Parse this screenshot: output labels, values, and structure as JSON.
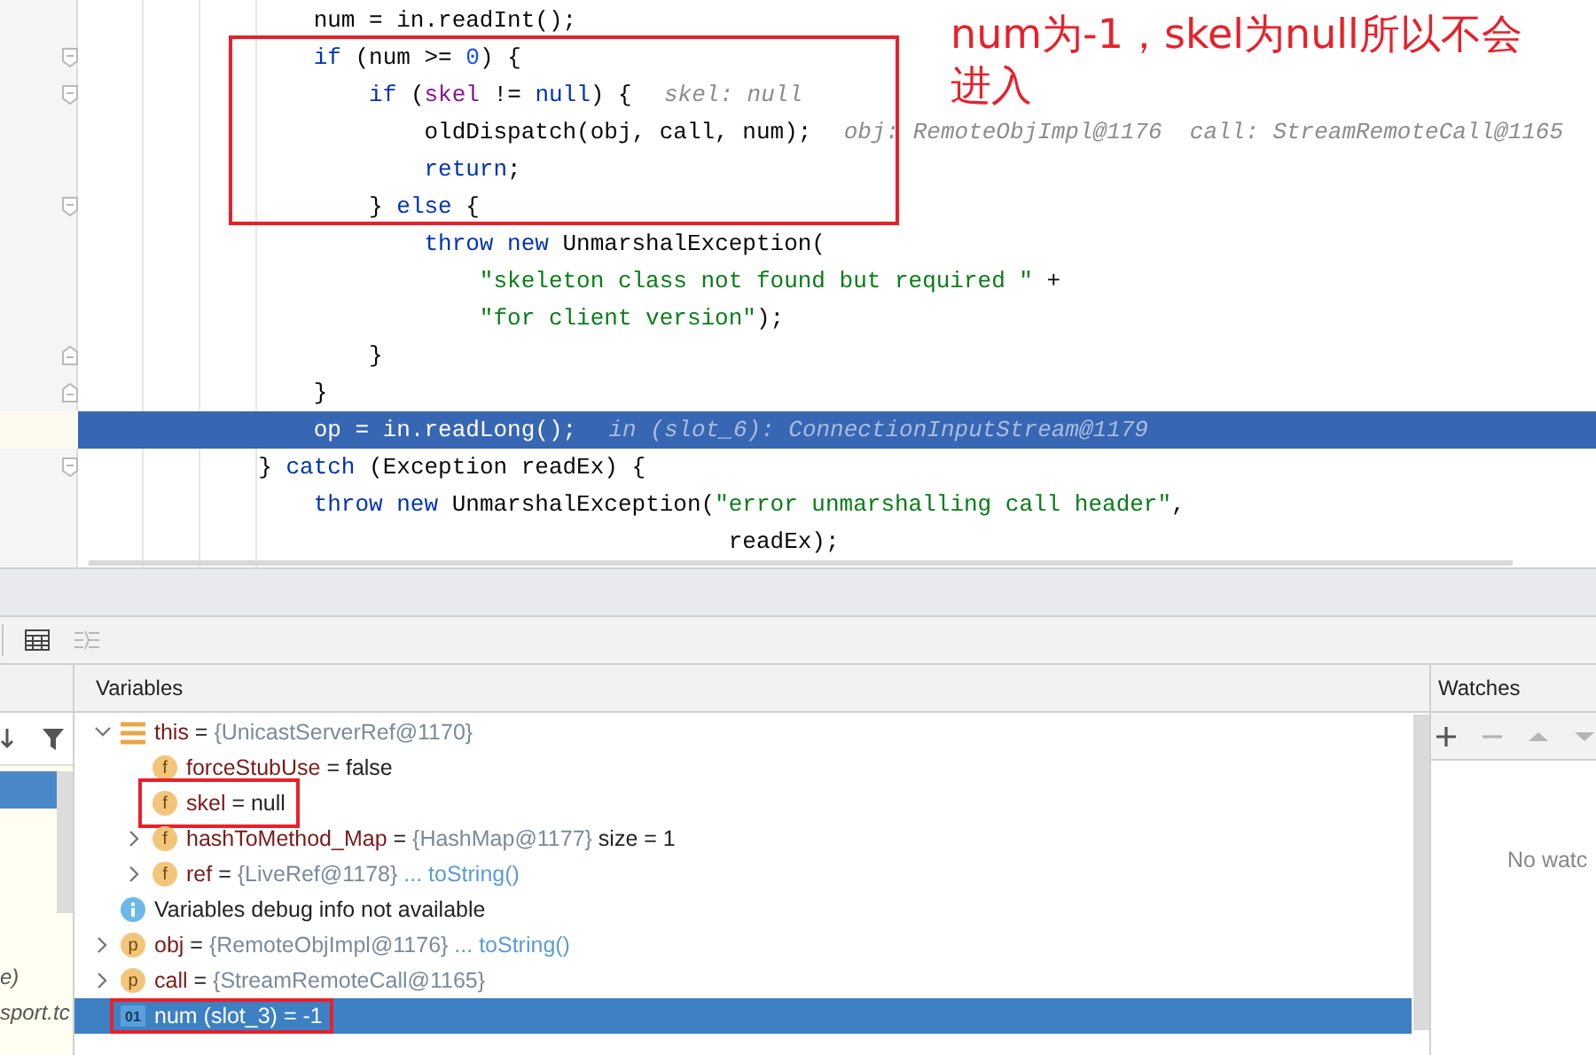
{
  "editor": {
    "lines": [
      {
        "fold_start": false,
        "fold_end": false,
        "current": false,
        "tokens": [
          {
            "kind": "plain",
            "text": "                num = in.readInt();"
          }
        ]
      },
      {
        "fold_start": true,
        "fold_end": false,
        "current": false,
        "tokens": [
          {
            "kind": "keyword",
            "text": "                if"
          },
          {
            "kind": "plain",
            "text": " (num >= "
          },
          {
            "kind": "number",
            "text": "0"
          },
          {
            "kind": "plain",
            "text": ") {"
          }
        ]
      },
      {
        "fold_start": true,
        "fold_end": false,
        "current": false,
        "tokens": [
          {
            "kind": "keyword",
            "text": "                    if"
          },
          {
            "kind": "plain",
            "text": " ("
          },
          {
            "kind": "field",
            "text": "skel"
          },
          {
            "kind": "plain",
            "text": " != "
          },
          {
            "kind": "keyword",
            "text": "null"
          },
          {
            "kind": "plain",
            "text": ") {"
          },
          {
            "kind": "hint",
            "text": "skel: null"
          }
        ]
      },
      {
        "fold_start": false,
        "fold_end": false,
        "current": false,
        "tokens": [
          {
            "kind": "plain",
            "text": "                        oldDispatch(obj, call, num);"
          },
          {
            "kind": "hint",
            "text": "obj: RemoteObjImpl@1176  call: StreamRemoteCall@1165"
          }
        ]
      },
      {
        "fold_start": false,
        "fold_end": false,
        "current": false,
        "tokens": [
          {
            "kind": "keyword",
            "text": "                        return"
          },
          {
            "kind": "plain",
            "text": ";"
          }
        ]
      },
      {
        "fold_start": true,
        "fold_end": false,
        "current": false,
        "tokens": [
          {
            "kind": "plain",
            "text": "                    } "
          },
          {
            "kind": "keyword",
            "text": "else"
          },
          {
            "kind": "plain",
            "text": " {"
          }
        ]
      },
      {
        "fold_start": false,
        "fold_end": false,
        "current": false,
        "tokens": [
          {
            "kind": "keyword",
            "text": "                        throw new"
          },
          {
            "kind": "plain",
            "text": " UnmarshalException("
          }
        ]
      },
      {
        "fold_start": false,
        "fold_end": false,
        "current": false,
        "tokens": [
          {
            "kind": "string",
            "text": "                            \"skeleton class not found but required \""
          },
          {
            "kind": "plain",
            "text": " +"
          }
        ]
      },
      {
        "fold_start": false,
        "fold_end": false,
        "current": false,
        "tokens": [
          {
            "kind": "string",
            "text": "                            \"for client version\""
          },
          {
            "kind": "plain",
            "text": ");"
          }
        ]
      },
      {
        "fold_start": false,
        "fold_end": true,
        "current": false,
        "tokens": [
          {
            "kind": "plain",
            "text": "                    }"
          }
        ]
      },
      {
        "fold_start": false,
        "fold_end": true,
        "current": false,
        "tokens": [
          {
            "kind": "plain",
            "text": "                }"
          }
        ]
      },
      {
        "fold_start": false,
        "fold_end": false,
        "current": true,
        "tokens": [
          {
            "kind": "plain",
            "text": "                op = in.readLong();"
          },
          {
            "kind": "hint",
            "text": "in (slot_6): ConnectionInputStream@1179"
          }
        ]
      },
      {
        "fold_start": true,
        "fold_end": false,
        "current": false,
        "tokens": [
          {
            "kind": "plain",
            "text": "            } "
          },
          {
            "kind": "keyword",
            "text": "catch"
          },
          {
            "kind": "plain",
            "text": " (Exception readEx) {"
          }
        ]
      },
      {
        "fold_start": false,
        "fold_end": false,
        "current": false,
        "tokens": [
          {
            "kind": "keyword",
            "text": "                throw new"
          },
          {
            "kind": "plain",
            "text": " UnmarshalException("
          },
          {
            "kind": "string",
            "text": "\"error unmarshalling call header\""
          },
          {
            "kind": "plain",
            "text": ","
          }
        ]
      },
      {
        "fold_start": false,
        "fold_end": false,
        "current": false,
        "tokens": [
          {
            "kind": "plain",
            "text": "                                              readEx);"
          }
        ]
      }
    ]
  },
  "annotation": {
    "text": "num为-1，skel为null所以不会进入"
  },
  "debugger": {
    "toolbar": [
      {
        "kind": "table",
        "disabled": false
      },
      {
        "kind": "split",
        "disabled": true
      }
    ],
    "frames": {
      "tools": [
        {
          "kind": "step-down"
        },
        {
          "kind": "filter"
        }
      ],
      "items": [
        {
          "selected": true
        },
        {
          "text": "e)",
          "selected": false
        },
        {
          "text": "sport.tc",
          "selected": false
        }
      ]
    },
    "variables": {
      "title": "Variables",
      "rows": [
        {
          "kind": "object",
          "expanded": true,
          "selected": false,
          "boxed": false,
          "name": "this",
          "parts": [
            {
              "kind": "plain",
              "text": " = "
            },
            {
              "kind": "ref",
              "text": "{UnicastServerRef@1170}"
            }
          ],
          "children": [
            {
              "kind": "field",
              "badge": "f",
              "selected": false,
              "boxed": false,
              "name": "forceStubUse",
              "parts": [
                {
                  "kind": "plain",
                  "text": " = false"
                }
              ]
            },
            {
              "kind": "field",
              "badge": "f",
              "selected": false,
              "boxed": true,
              "name": "skel",
              "parts": [
                {
                  "kind": "plain",
                  "text": " = null"
                }
              ]
            },
            {
              "kind": "field",
              "badge": "f",
              "expanded": false,
              "selected": false,
              "boxed": false,
              "name": "hashToMethod_Map",
              "parts": [
                {
                  "kind": "plain",
                  "text": " = "
                },
                {
                  "kind": "ref",
                  "text": "{HashMap@1177}"
                },
                {
                  "kind": "plain",
                  "text": "  size = 1"
                }
              ]
            },
            {
              "kind": "field",
              "badge": "f",
              "expanded": false,
              "selected": false,
              "boxed": false,
              "name": "ref",
              "parts": [
                {
                  "kind": "plain",
                  "text": " = "
                },
                {
                  "kind": "ref",
                  "text": "{LiveRef@1178}"
                },
                {
                  "kind": "link",
                  "text": " ... toString()"
                }
              ]
            }
          ]
        },
        {
          "kind": "info",
          "selected": false,
          "boxed": false,
          "name": "Variables debug info not available",
          "parts": []
        },
        {
          "kind": "param",
          "badge": "p",
          "expanded": false,
          "selected": false,
          "boxed": false,
          "name": "obj",
          "parts": [
            {
              "kind": "plain",
              "text": " = "
            },
            {
              "kind": "ref",
              "text": "{RemoteObjImpl@1176}"
            },
            {
              "kind": "link",
              "text": " ... toString()"
            }
          ]
        },
        {
          "kind": "param",
          "badge": "p",
          "expanded": false,
          "selected": false,
          "boxed": false,
          "name": "call",
          "parts": [
            {
              "kind": "plain",
              "text": " = "
            },
            {
              "kind": "ref",
              "text": "{StreamRemoteCall@1165}"
            }
          ]
        },
        {
          "kind": "local",
          "badge": "01",
          "selected": true,
          "boxed": true,
          "name": "num (slot_3)",
          "parts": [
            {
              "kind": "plain",
              "text": " = -1"
            }
          ]
        }
      ]
    },
    "watches": {
      "title": "Watches",
      "tools": [
        {
          "kind": "add",
          "disabled": false
        },
        {
          "kind": "remove",
          "disabled": true
        },
        {
          "kind": "up",
          "disabled": true
        },
        {
          "kind": "down",
          "disabled": true
        }
      ],
      "empty_text": "No watc"
    }
  }
}
